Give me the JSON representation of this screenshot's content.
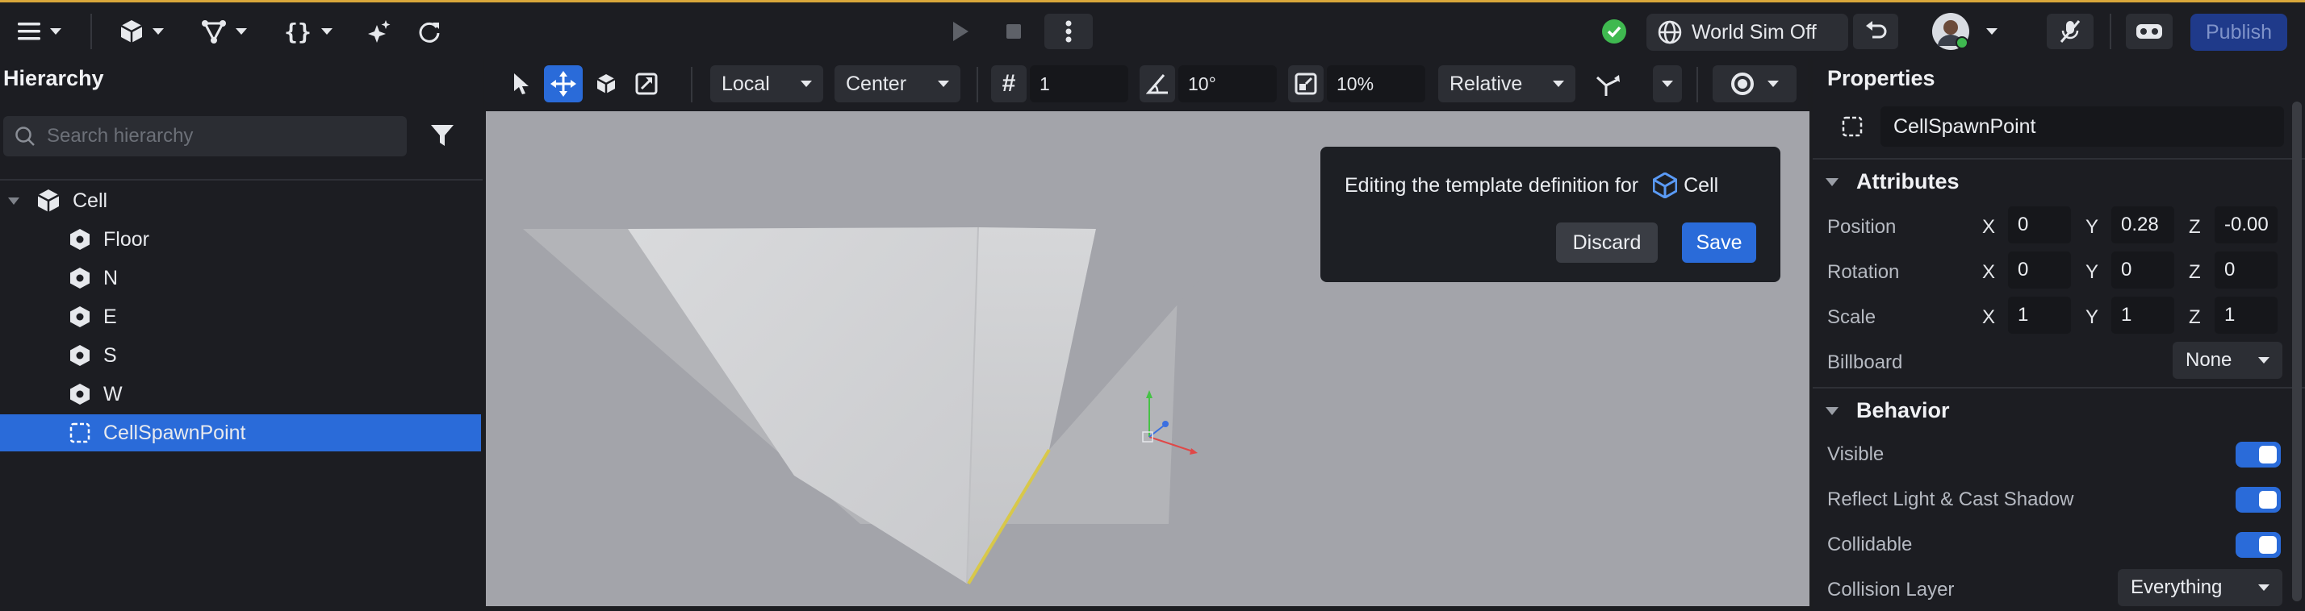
{
  "topbar": {
    "world_sim_label": "World Sim Off",
    "publish_label": "Publish",
    "colors": {
      "accent_line": "#d9a73b",
      "status_ok": "#3fb950",
      "publish_bg": "#1f3a8a"
    }
  },
  "hierarchy": {
    "title": "Hierarchy",
    "search_placeholder": "Search hierarchy",
    "items": [
      {
        "label": "Cell"
      },
      {
        "label": "Floor"
      },
      {
        "label": "N"
      },
      {
        "label": "E"
      },
      {
        "label": "S"
      },
      {
        "label": "W"
      },
      {
        "label": "CellSpawnPoint"
      }
    ]
  },
  "viewport_toolbar": {
    "space_label": "Local",
    "pivot_label": "Center",
    "grid_snap_value": "1",
    "rotation_snap_value": "10°",
    "scale_snap_value": "10%",
    "snap_mode_label": "Relative"
  },
  "template_popup": {
    "message": "Editing the template definition for",
    "template_name": "Cell",
    "discard_label": "Discard",
    "save_label": "Save"
  },
  "properties": {
    "title": "Properties",
    "object_name": "CellSpawnPoint",
    "attributes_heading": "Attributes",
    "position": {
      "label": "Position",
      "x": "0",
      "y": "0.28",
      "z": "-0.00"
    },
    "rotation": {
      "label": "Rotation",
      "x": "0",
      "y": "0",
      "z": "0"
    },
    "scale": {
      "label": "Scale",
      "x": "1",
      "y": "1",
      "z": "1"
    },
    "billboard": {
      "label": "Billboard",
      "value": "None"
    },
    "behavior_heading": "Behavior",
    "visible_label": "Visible",
    "reflect_label": "Reflect Light & Cast Shadow",
    "collidable_label": "Collidable",
    "collision_layer": {
      "label": "Collision Layer",
      "value": "Everything"
    },
    "axis_labels": {
      "x": "X",
      "y": "Y",
      "z": "Z"
    }
  }
}
